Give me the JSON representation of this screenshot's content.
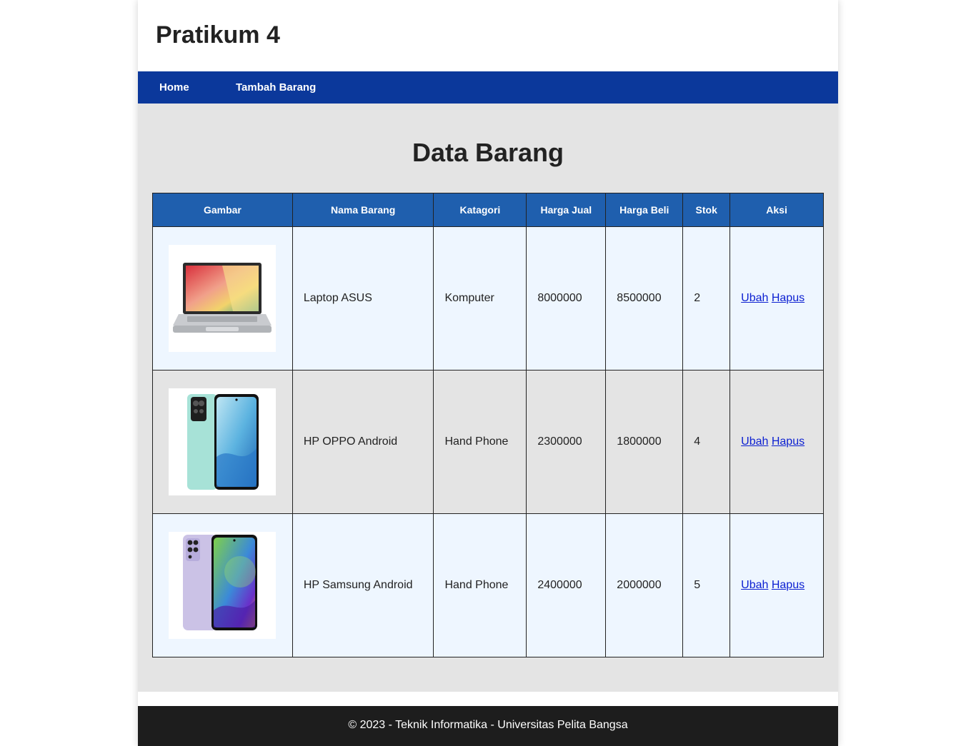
{
  "header": {
    "title": "Pratikum 4"
  },
  "nav": {
    "items": [
      {
        "label": "Home"
      },
      {
        "label": "Tambah Barang"
      }
    ]
  },
  "main": {
    "title": "Data Barang",
    "table": {
      "columns": [
        "Gambar",
        "Nama Barang",
        "Katagori",
        "Harga Jual",
        "Harga Beli",
        "Stok",
        "Aksi"
      ],
      "rows": [
        {
          "image": "laptop-image",
          "nama": "Laptop ASUS",
          "kategori": "Komputer",
          "harga_jual": "8000000",
          "harga_beli": "8500000",
          "stok": "2",
          "ubah": "Ubah",
          "hapus": "Hapus"
        },
        {
          "image": "phone-oppo-image",
          "nama": "HP OPPO Android",
          "kategori": "Hand Phone",
          "harga_jual": "2300000",
          "harga_beli": "1800000",
          "stok": "4",
          "ubah": "Ubah",
          "hapus": "Hapus"
        },
        {
          "image": "phone-samsung-image",
          "nama": "HP Samsung Android",
          "kategori": "Hand Phone",
          "harga_jual": "2400000",
          "harga_beli": "2000000",
          "stok": "5",
          "ubah": "Ubah",
          "hapus": "Hapus"
        }
      ]
    }
  },
  "footer": {
    "text": "© 2023 - Teknik Informatika - Universitas Pelita Bangsa"
  },
  "colors": {
    "nav": "#0b389b",
    "table_header": "#1f5fae",
    "footer": "#1d1d1d",
    "link": "#0b1fd1"
  }
}
